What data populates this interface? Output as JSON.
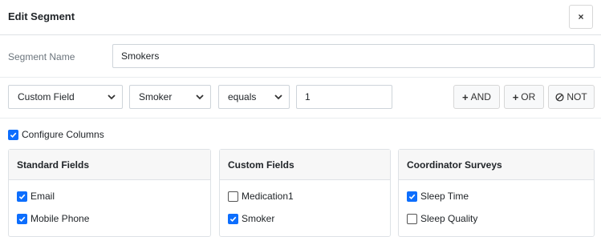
{
  "modal": {
    "title": "Edit Segment",
    "close_label": "×"
  },
  "segment_name": {
    "label": "Segment Name",
    "value": "Smokers"
  },
  "filter": {
    "field_type": "Custom Field",
    "field": "Smoker",
    "operator": "equals",
    "value": "1",
    "and_label": "AND",
    "or_label": "OR",
    "not_label": "NOT"
  },
  "configure_columns": {
    "label": "Configure Columns",
    "checked": true
  },
  "panels": [
    {
      "title": "Standard Fields",
      "items": [
        {
          "label": "Email",
          "checked": true
        },
        {
          "label": "Mobile Phone",
          "checked": true
        }
      ]
    },
    {
      "title": "Custom Fields",
      "items": [
        {
          "label": "Medication1",
          "checked": false
        },
        {
          "label": "Smoker",
          "checked": true
        }
      ]
    },
    {
      "title": "Coordinator Surveys",
      "items": [
        {
          "label": "Sleep Time",
          "checked": true
        },
        {
          "label": "Sleep Quality",
          "checked": false
        }
      ]
    }
  ],
  "colors": {
    "accent": "#0d6efd",
    "border": "#ced4da",
    "panel_header_bg": "#f7f7f7"
  }
}
